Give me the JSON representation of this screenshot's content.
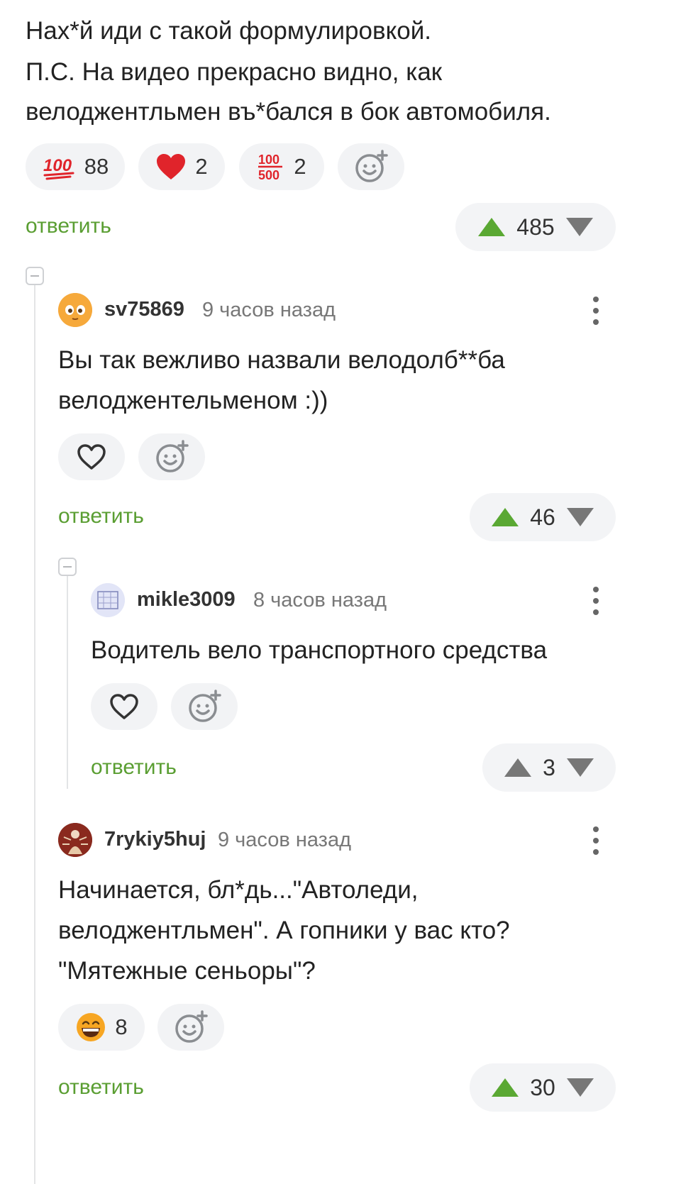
{
  "top_comment": {
    "lines": [
      "Нах*й иди с такой формулировкой.",
      "П.С. На видео прекрасно видно, как",
      "велоджентльмен въ*бался в бок автомобиля."
    ],
    "reactions": [
      {
        "icon": "hundred-points-icon",
        "count": "88"
      },
      {
        "icon": "heart-icon",
        "count": "2"
      },
      {
        "icon": "hundred-five-hundred-icon",
        "count": "2"
      }
    ],
    "reply_label": "ответить",
    "rating": "485"
  },
  "comments": [
    {
      "author": "sv75869",
      "time": "9 часов назад",
      "lines": [
        "Вы так вежливо назвали велодолб**ба",
        "велоджентельменом :))"
      ],
      "reply_label": "ответить",
      "rating": "46"
    },
    {
      "author": "mikle3009",
      "time": "8 часов назад",
      "lines": [
        "Водитель вело транспортного средства"
      ],
      "reply_label": "ответить",
      "rating": "3"
    },
    {
      "author": "7rykiy5huj",
      "time": "9 часов назад",
      "lines": [
        "Начинается, бл*дь...\"Автоледи,",
        "велоджентльмен\". А гопники у вас кто?",
        "\"Мятежные сеньоры\"?"
      ],
      "reactions": [
        {
          "icon": "grinning-face-icon",
          "count": "8"
        }
      ],
      "reply_label": "ответить",
      "rating": "30"
    }
  ],
  "colors": {
    "accent": "#5a9e32",
    "upvote": "#5aa833",
    "downvote": "#777777",
    "heart": "#e0242b",
    "hundred": "#e0242b"
  }
}
